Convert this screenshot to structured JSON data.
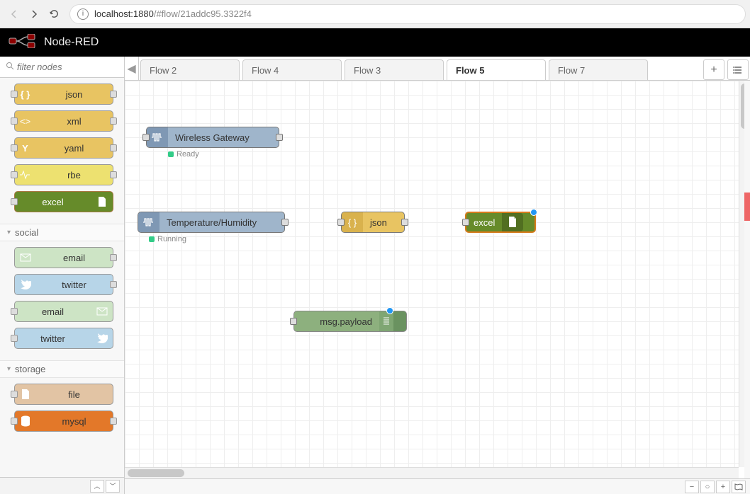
{
  "browser": {
    "url_host": "localhost:",
    "url_port": "1880",
    "url_path": "/#flow/21addc95.3322f4"
  },
  "app": {
    "title": "Node-RED"
  },
  "sidebar": {
    "filter_placeholder": "filter nodes",
    "items_parser": [
      {
        "label": "json",
        "color": "c-yellow",
        "icon": "braces"
      },
      {
        "label": "xml",
        "color": "c-yellow",
        "icon": "tag"
      },
      {
        "label": "yaml",
        "color": "c-yellow",
        "icon": "y"
      },
      {
        "label": "rbe",
        "color": "c-yellow-lt",
        "icon": "pulse"
      },
      {
        "label": "excel",
        "color": "c-olive",
        "icon": "file",
        "icon_right": true
      }
    ],
    "cat_social": "social",
    "items_social": [
      {
        "label": "email",
        "color": "c-green-lt",
        "icon": "mail",
        "port_right": true
      },
      {
        "label": "twitter",
        "color": "c-blue-lt",
        "icon": "bird",
        "port_right": true
      },
      {
        "label": "email",
        "color": "c-green-lt",
        "icon": "mail",
        "icon_right": true,
        "port_left": true
      },
      {
        "label": "twitter",
        "color": "c-blue-lt",
        "icon": "bird",
        "icon_right": true,
        "port_left": true
      }
    ],
    "cat_storage": "storage",
    "items_storage": [
      {
        "label": "file",
        "color": "c-tan",
        "icon": "file",
        "port_left": true
      },
      {
        "label": "mysql",
        "color": "c-orange",
        "icon": "db",
        "port_left": true,
        "port_right": true
      }
    ]
  },
  "tabs": [
    "Flow 2",
    "Flow 4",
    "Flow 3",
    "Flow 5",
    "Flow 7"
  ],
  "active_tab": 3,
  "canvas": {
    "nodes": {
      "gateway": {
        "label": "Wireless Gateway",
        "status": "Ready"
      },
      "sensor": {
        "label": "Temperature/Humidity",
        "status": "Running"
      },
      "json": {
        "label": "json"
      },
      "excel": {
        "label": "excel"
      },
      "debug": {
        "label": "msg.payload"
      }
    }
  }
}
